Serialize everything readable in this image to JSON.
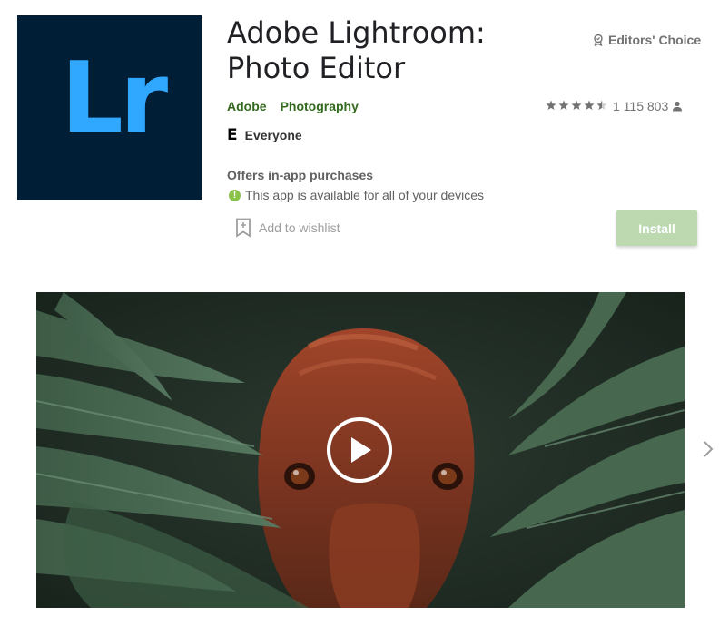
{
  "app": {
    "icon_text": "Lr",
    "title": "Adobe Lightroom: Photo Editor",
    "editors_choice": "Editors' Choice",
    "developer": "Adobe",
    "category": "Photography",
    "rating_stars": 4.5,
    "rating_count": "1 115 803",
    "content_rating": "Everyone",
    "content_rating_symbol": "E",
    "in_app_purchases": "Offers in-app purchases",
    "availability": "This app is available for all of your devices",
    "wishlist_label": "Add to wishlist",
    "install_label": "Install"
  },
  "colors": {
    "icon_bg": "#001e36",
    "icon_text": "#31a8ff",
    "developer_link": "#33691e",
    "install_button": "#bcd9b0",
    "info_dot": "#8bc34a"
  },
  "icons": {
    "editors_choice": "badge-icon",
    "rating_user": "person-icon",
    "wishlist": "bookmark-icon",
    "info": "info-icon",
    "play": "play-icon",
    "next": "chevron-right-icon"
  }
}
